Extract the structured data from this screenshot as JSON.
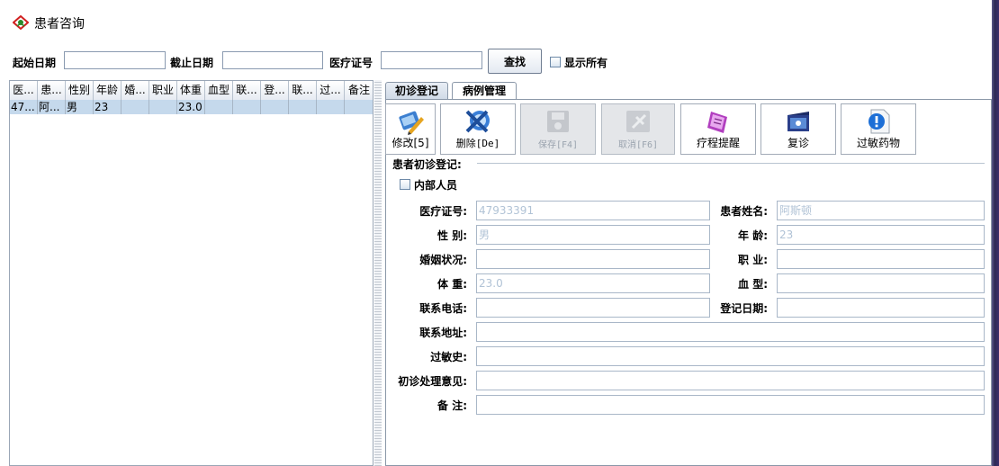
{
  "window": {
    "title": "患者咨询",
    "icon": "app-logo-icon"
  },
  "search": {
    "start_date_label": "起始日期",
    "start_date_value": "",
    "end_date_label": "截止日期",
    "end_date_value": "",
    "med_id_label": "医疗证号",
    "med_id_value": "",
    "search_button": "查找",
    "show_all_label": "显示所有",
    "show_all_checked": false
  },
  "table": {
    "columns": [
      "医...",
      "患...",
      "性别",
      "年龄",
      "婚...",
      "职业",
      "体重",
      "血型",
      "联...",
      "登...",
      "联...",
      "过...",
      "备注"
    ],
    "rows": [
      [
        "47...",
        "阿...",
        "男",
        "23",
        "",
        "",
        "23.0",
        "",
        "",
        "",
        "",
        "",
        ""
      ]
    ]
  },
  "tabs": {
    "initial": "初诊登记",
    "cases": "病例管理",
    "active": "initial"
  },
  "toolbar": [
    {
      "label": "修改[5]",
      "icon": "edit-icon",
      "enabled": true
    },
    {
      "label": "删除[De]",
      "icon": "delete-icon",
      "enabled": true
    },
    {
      "label": "保存[F4]",
      "icon": "save-icon",
      "enabled": false
    },
    {
      "label": "取消[F6]",
      "icon": "cancel-icon",
      "enabled": false
    },
    {
      "label": "疗程提醒",
      "icon": "reminder-icon",
      "enabled": true
    },
    {
      "label": "复诊",
      "icon": "revisit-icon",
      "enabled": true
    },
    {
      "label": "过敏药物",
      "icon": "allergy-drug-icon",
      "enabled": true
    }
  ],
  "form": {
    "group_title": "患者初诊登记:",
    "internal_staff_label": "内部人员",
    "internal_staff_checked": false,
    "labels": {
      "med_id": "医疗证号:",
      "name": "患者姓名:",
      "gender": "性  别:",
      "age": "年  龄:",
      "marital": "婚姻状况:",
      "occupation": "职  业:",
      "weight": "体  重:",
      "blood": "血  型:",
      "phone": "联系电话:",
      "reg_date": "登记日期:",
      "address": "联系地址:",
      "allergy": "过敏史:",
      "opinion": "初诊处理意见:",
      "remark": "备  注:"
    },
    "values": {
      "med_id": "47933391",
      "name": "阿斯顿",
      "gender": "男",
      "age": "23",
      "marital": "",
      "occupation": "",
      "weight": "23.0",
      "blood": "",
      "phone": "",
      "reg_date": "",
      "address": "",
      "allergy": "",
      "opinion": "",
      "remark": ""
    }
  }
}
